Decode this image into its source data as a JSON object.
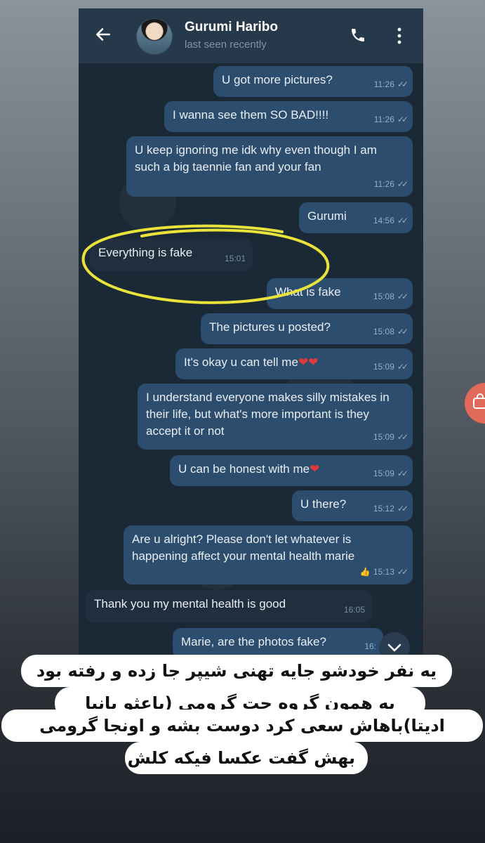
{
  "header": {
    "contact_name": "Gurumi Haribo",
    "status": "last seen recently"
  },
  "messages": [
    {
      "dir": "out",
      "text": "U got more pictures?",
      "time": "11:26"
    },
    {
      "dir": "out",
      "text": "I wanna see them SO BAD!!!!",
      "time": "11:26"
    },
    {
      "dir": "out",
      "text": "U keep ignoring me idk why even though I am such a big taennie fan and your fan",
      "time": "11:26"
    },
    {
      "dir": "out",
      "text": "Gurumi",
      "time": "14:56"
    },
    {
      "dir": "in",
      "text": "Everything is fake",
      "time": "15:01"
    },
    {
      "dir": "out",
      "text": "What is fake",
      "time": "15:08"
    },
    {
      "dir": "out",
      "text": "The pictures u posted?",
      "time": "15:08"
    },
    {
      "dir": "out",
      "text": "It's okay u can tell me",
      "emoji": "❤❤",
      "time": "15:09"
    },
    {
      "dir": "out",
      "text": "I understand everyone makes silly mistakes in their life, but what's more important is they accept it or not",
      "time": "15:09"
    },
    {
      "dir": "out",
      "text": "U can be honest with me",
      "emoji": "❤",
      "time": "15:09"
    },
    {
      "dir": "out",
      "text": "U there?",
      "time": "15:12"
    },
    {
      "dir": "out",
      "text": "Are u alright? Please don't let whatever is happening affect your mental health marie",
      "time": "15:13",
      "reaction": "👍"
    },
    {
      "dir": "in",
      "text": "Thank you my mental health is good",
      "time": "16:05"
    },
    {
      "dir": "out",
      "text": "Marie, are the photos fake?",
      "time": "16:"
    }
  ],
  "caption": {
    "line1": "یه نفر خودشو جایه تهنی شیپر جا زده و رفته بود",
    "line2": "به همون گروه چت گرومی (باعثو بانیا",
    "line3": "ادیتا)باهاش سعی کرد دوست بشه و اونجا گرومی",
    "line4": "بهش گفت عکسا فیکه کلش"
  },
  "colors": {
    "outgoing_bubble": "#2c4d6d",
    "incoming_bubble": "#1f2f3e",
    "header_bg": "#26394b",
    "annotation_circle": "#e8e23a"
  },
  "icons": [
    "back-arrow-icon",
    "phone-icon",
    "more-vertical-icon",
    "double-check-icon",
    "chevron-down-icon"
  ]
}
